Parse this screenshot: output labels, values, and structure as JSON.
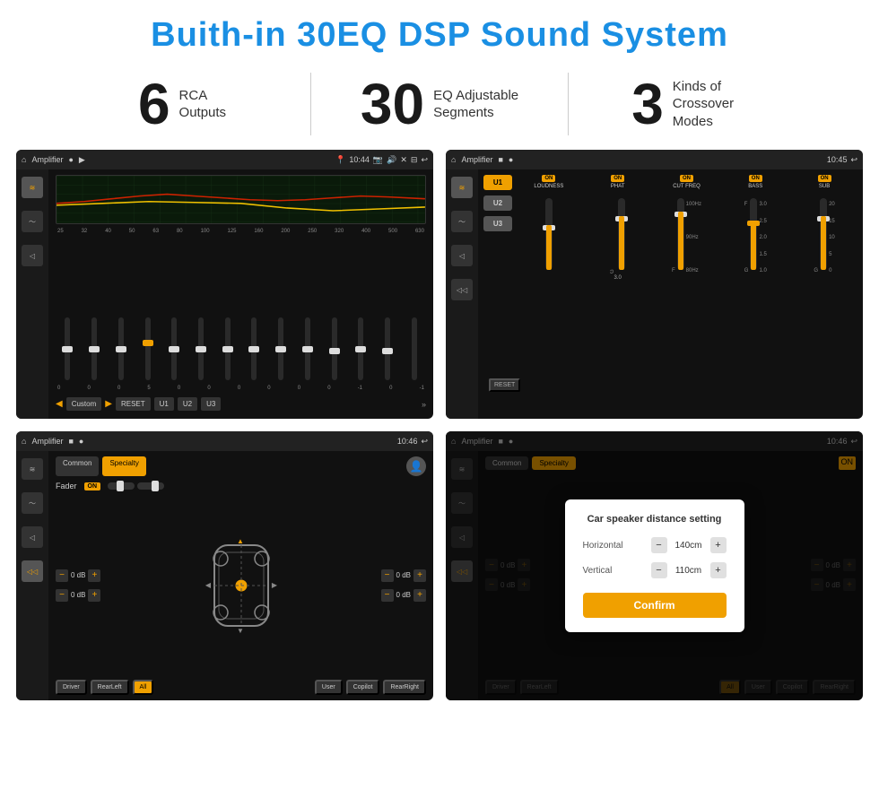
{
  "page": {
    "title": "Buith-in 30EQ DSP Sound System",
    "stats": [
      {
        "number": "6",
        "label": "RCA\nOutputs"
      },
      {
        "number": "30",
        "label": "EQ Adjustable\nSegments"
      },
      {
        "number": "3",
        "label": "Kinds of\nCrossover Modes"
      }
    ]
  },
  "screens": {
    "screen1": {
      "topbar": {
        "title": "Amplifier",
        "time": "10:44"
      },
      "freqs": [
        "25",
        "32",
        "40",
        "50",
        "63",
        "80",
        "100",
        "125",
        "160",
        "200",
        "250",
        "320",
        "400",
        "500",
        "630"
      ],
      "sliders": [
        {
          "pos": 50,
          "val": "0"
        },
        {
          "pos": 50,
          "val": "0"
        },
        {
          "pos": 50,
          "val": "0"
        },
        {
          "pos": 45,
          "val": "5"
        },
        {
          "pos": 50,
          "val": "0"
        },
        {
          "pos": 50,
          "val": "0"
        },
        {
          "pos": 50,
          "val": "0"
        },
        {
          "pos": 50,
          "val": "0"
        },
        {
          "pos": 50,
          "val": "0"
        },
        {
          "pos": 50,
          "val": "0"
        },
        {
          "pos": 48,
          "val": "-1"
        },
        {
          "pos": 50,
          "val": "0"
        },
        {
          "pos": 48,
          "val": "-1"
        }
      ],
      "buttons": [
        "Custom",
        "RESET",
        "U1",
        "U2",
        "U3"
      ]
    },
    "screen2": {
      "topbar": {
        "title": "Amplifier",
        "time": "10:45"
      },
      "presets": [
        "U1",
        "U2",
        "U3"
      ],
      "controls": [
        {
          "name": "LOUDNESS",
          "on": true
        },
        {
          "name": "PHAT",
          "on": true
        },
        {
          "name": "CUT FREQ",
          "on": true
        },
        {
          "name": "BASS",
          "on": true
        },
        {
          "name": "SUB",
          "on": true
        }
      ],
      "reset_label": "RESET"
    },
    "screen3": {
      "topbar": {
        "title": "Amplifier",
        "time": "10:46"
      },
      "tabs": [
        "Common",
        "Specialty"
      ],
      "active_tab": 1,
      "fader_label": "Fader",
      "fader_on": "ON",
      "db_values": [
        "0 dB",
        "0 dB",
        "0 dB",
        "0 dB"
      ],
      "bottom_btns": [
        "Driver",
        "RearLeft",
        "All",
        "Copilot",
        "RearRight",
        "User"
      ]
    },
    "screen4": {
      "topbar": {
        "title": "Amplifier",
        "time": "10:46"
      },
      "tabs": [
        "Common",
        "Specialty"
      ],
      "dialog": {
        "title": "Car speaker distance setting",
        "horizontal_label": "Horizontal",
        "horizontal_value": "140cm",
        "vertical_label": "Vertical",
        "vertical_value": "110cm",
        "confirm_label": "Confirm"
      },
      "db_values": [
        "0 dB",
        "0 dB"
      ],
      "bottom_btns": [
        "Driver",
        "RearLeft",
        "All",
        "Copilot",
        "RearRight",
        "User"
      ]
    }
  },
  "icons": {
    "home": "⌂",
    "back": "↩",
    "eq_icon": "≋",
    "wave_icon": "~",
    "volume_icon": "◁",
    "speaker_icon": "♪",
    "minus": "−",
    "plus": "+"
  }
}
